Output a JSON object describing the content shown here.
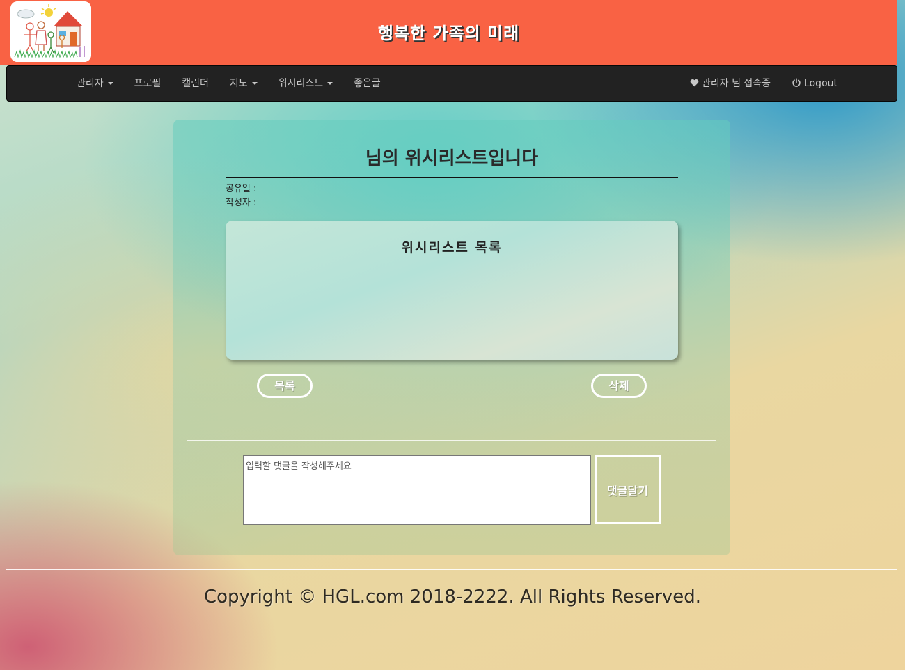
{
  "header": {
    "site_title": "행복한 가족의 미래"
  },
  "navbar": {
    "left_items": [
      {
        "label": "관리자",
        "dropdown": true
      },
      {
        "label": "프로필",
        "dropdown": false
      },
      {
        "label": "캘린더",
        "dropdown": false
      },
      {
        "label": "지도",
        "dropdown": true
      },
      {
        "label": "위시리스트",
        "dropdown": true
      },
      {
        "label": "좋은글",
        "dropdown": false
      }
    ],
    "user_status": "관리자 님 접속중",
    "logout_label": "Logout"
  },
  "main": {
    "heading": "님의 위시리스트입니다",
    "share_date_label": "공유일 :",
    "writer_label": "작성자 :",
    "wishlist_title": "위시리스트 목록",
    "list_button": "목록",
    "delete_button": "삭제",
    "comment_placeholder": "입력할 댓글을 작성해주세요",
    "comment_button": "댓글달기"
  },
  "footer": {
    "copyright": "Copyright © HGL.com 2018-2222. All Rights Reserved."
  },
  "colors": {
    "header_bg": "#f96244",
    "navbar_bg": "#222222",
    "nav_text": "#c8c8c8"
  }
}
